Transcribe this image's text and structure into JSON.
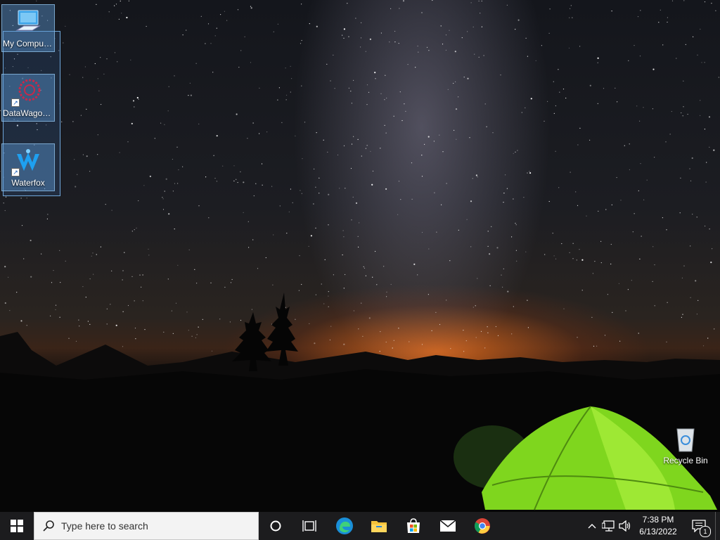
{
  "desktop": {
    "icons": [
      {
        "label": "My Computer",
        "icon": "computer-icon"
      },
      {
        "label": "DataWagon...",
        "icon": "datawagon-icon"
      },
      {
        "label": "Waterfox",
        "icon": "waterfox-icon"
      },
      {
        "label": "Recycle Bin",
        "icon": "recycle-bin-icon"
      }
    ]
  },
  "taskbar": {
    "search_placeholder": "Type here to search",
    "apps": [
      "start-icon",
      "cortana-icon",
      "task-view-icon",
      "edge-icon",
      "file-explorer-icon",
      "store-icon",
      "mail-icon",
      "chrome-icon"
    ],
    "clock": {
      "time": "7:38 PM",
      "date": "6/13/2022"
    },
    "notification_count": "1"
  },
  "colors": {
    "taskbar": "#1c1c1e",
    "selection": "#5a96d2",
    "tent_green": "#7fd61e",
    "horizon_orange": "#e66e1e"
  }
}
